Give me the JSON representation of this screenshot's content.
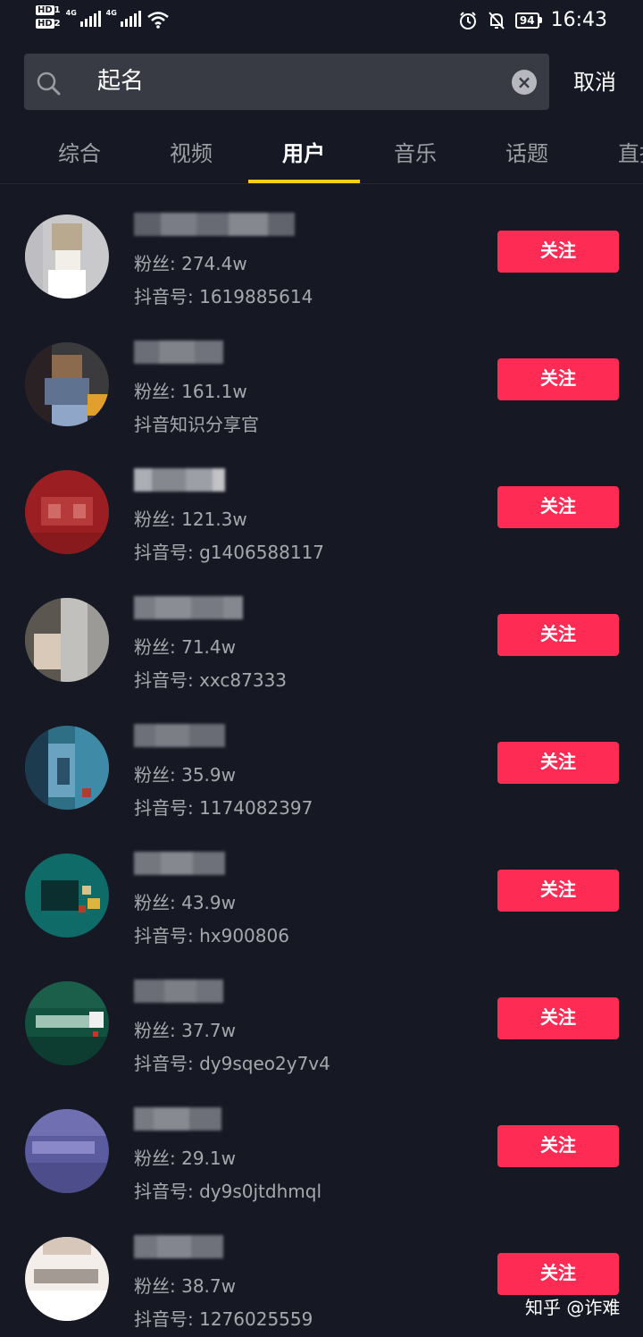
{
  "status_bar": {
    "hd1": "HD",
    "hd1_sub": "1",
    "hd2": "HD",
    "hd2_sub": "2",
    "network1": "4G",
    "network2": "4G",
    "battery": "94",
    "time": "16:43",
    "icons": [
      "alarm-icon",
      "mute-bell-icon",
      "wifi-icon",
      "signal-icon"
    ]
  },
  "search": {
    "query": "起名",
    "cancel_label": "取消"
  },
  "tabs": [
    {
      "label": "综合"
    },
    {
      "label": "视频"
    },
    {
      "label": "用户"
    },
    {
      "label": "音乐"
    },
    {
      "label": "话题"
    },
    {
      "label": "直播"
    }
  ],
  "active_tab": "用户",
  "users": [
    {
      "fans": "粉丝: 274.4w",
      "uid": "抖音号: 1619885614",
      "follow_label": "关注"
    },
    {
      "fans": "粉丝: 161.1w",
      "uid": "抖音知识分享官",
      "follow_label": "关注"
    },
    {
      "fans": "粉丝: 121.3w",
      "uid": "抖音号: g1406588117",
      "follow_label": "关注"
    },
    {
      "fans": "粉丝: 71.4w",
      "uid": "抖音号: xxc87333",
      "follow_label": "关注"
    },
    {
      "fans": "粉丝: 35.9w",
      "uid": "抖音号: 1174082397",
      "follow_label": "关注"
    },
    {
      "fans": "粉丝: 43.9w",
      "uid": "抖音号: hx900806",
      "follow_label": "关注"
    },
    {
      "fans": "粉丝: 37.7w",
      "uid": "抖音号: dy9sqeo2y7v4",
      "follow_label": "关注"
    },
    {
      "fans": "粉丝: 29.1w",
      "uid": "抖音号: dy9s0jtdhmql",
      "follow_label": "关注"
    },
    {
      "fans": "粉丝: 38.7w",
      "uid": "抖音号: 1276025559",
      "follow_label": "关注"
    }
  ],
  "watermark": "知乎 @诈难",
  "colors": {
    "background": "#161823",
    "search_field": "#393b44",
    "follow_button": "#fe2c55",
    "tab_indicator": "#face15"
  }
}
